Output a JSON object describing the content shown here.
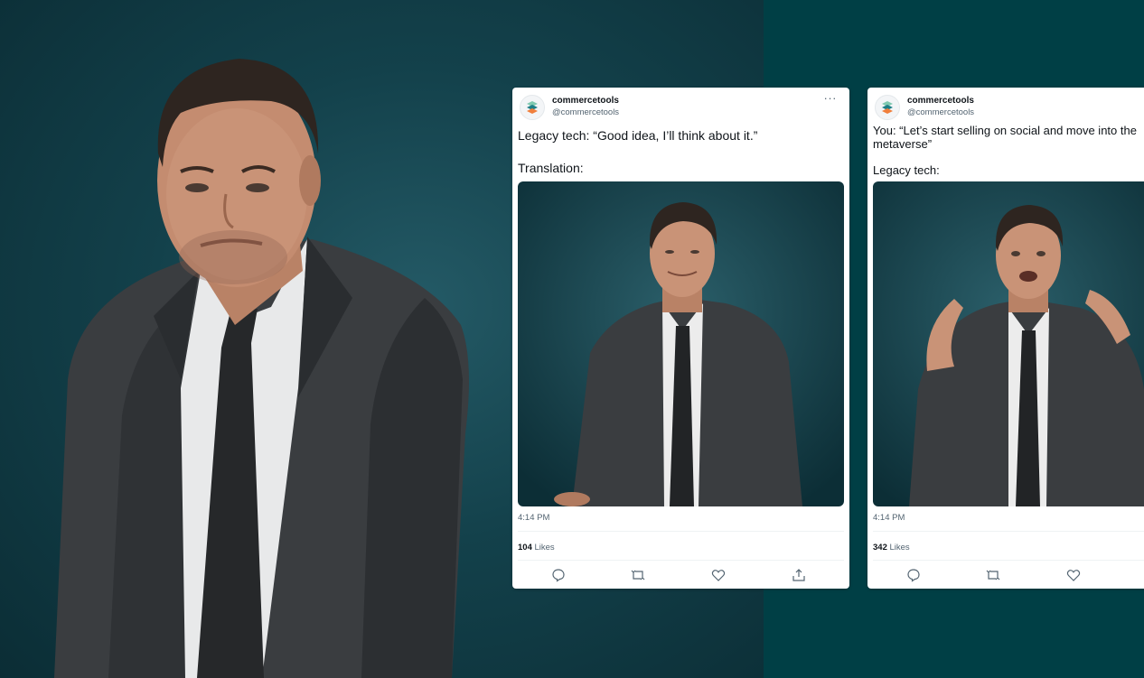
{
  "tweets": [
    {
      "name": "commercetools",
      "handle": "@commercetools",
      "more_label": "···",
      "lines": [
        "Legacy tech: “Good idea, I’ll think about it.”",
        "Translation:"
      ],
      "time": "4:14 PM",
      "likes_count": "104",
      "likes_label": "Likes"
    },
    {
      "name": "commercetools",
      "handle": "@commercetools",
      "lines": [
        "You: “Let’s start selling on social and move into the",
        "metaverse”",
        "Legacy tech:"
      ],
      "time": "4:14 PM",
      "likes_count": "342",
      "likes_label": "Likes"
    }
  ],
  "colors": {
    "brand_teal": "#003f45",
    "logo_green": "#7fc9b0",
    "logo_orange": "#f07f3c",
    "logo_teal": "#1d7e86"
  },
  "icons": [
    "reply-icon",
    "retweet-icon",
    "like-icon",
    "share-icon"
  ]
}
